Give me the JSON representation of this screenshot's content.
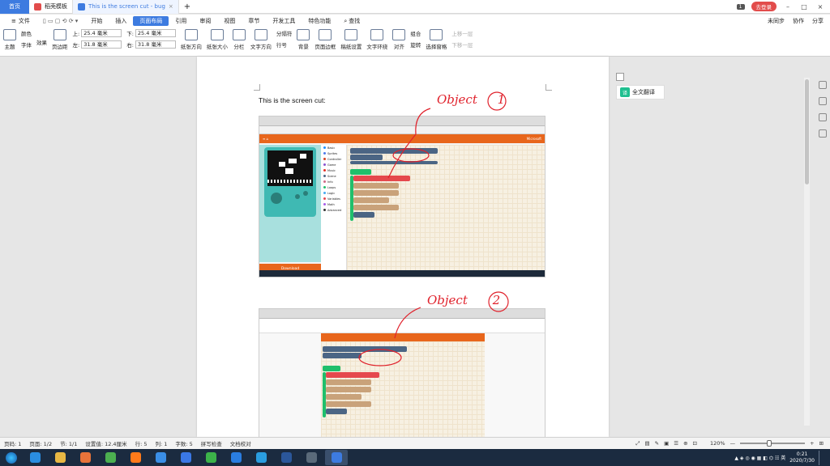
{
  "titlebar": {
    "home": "首页",
    "tabs": [
      {
        "label": "稻壳模板",
        "color": "#e24c4b",
        "active": false
      },
      {
        "label": "This is the screen cut - bug",
        "color": "#3d7be0",
        "active": true
      }
    ],
    "add_tab": "+",
    "badge": "1",
    "login": "去登录"
  },
  "menubar": {
    "file": "文件",
    "items": [
      "开始",
      "插入",
      "页面布局",
      "引用",
      "审阅",
      "视图",
      "章节",
      "开发工具",
      "特色功能"
    ],
    "active": "页面布局",
    "search": "查找",
    "right": [
      "未同步",
      "协作",
      "分享"
    ]
  },
  "ribbon": {
    "theme": "主题",
    "color": "颜色",
    "font": "字体",
    "effect": "效果",
    "margins": "页边距",
    "top_label": "上:",
    "top_value": "25.4 毫米",
    "bottom_label": "下:",
    "bottom_value": "25.4 毫米",
    "left_label": "左:",
    "left_value": "31.8 毫米",
    "right_label": "右:",
    "right_value": "31.8 毫米",
    "orientation": "纸张方向",
    "size": "纸张大小",
    "columns": "分栏",
    "text_direction": "文字方向",
    "breaks": "分隔符",
    "line_numbers": "行号",
    "background": "背景",
    "page_border": "页面边框",
    "manuscript": "稿纸设置",
    "wrap": "文字环绕",
    "align": "对齐",
    "group": "组合",
    "rotate": "旋转",
    "select_pane": "选择窗格",
    "bring_forward": "上移一层",
    "send_backward": "下移一层"
  },
  "document": {
    "text": "This is the screen cut:",
    "annotation1": "Object",
    "annotation1_num": "1",
    "annotation2": "Object",
    "annotation2_num": "2",
    "download": "Download",
    "microsoft": "Microsoft",
    "toolbox": [
      "Basic",
      "Sprites",
      "Controller",
      "Game",
      "Music",
      "Scene",
      "Info",
      "Loops",
      "Logic",
      "Variables",
      "Math",
      "Advanced"
    ]
  },
  "sidepanel": {
    "translate": "全文翻译"
  },
  "statusbar": {
    "page_num": "页码: 1",
    "pages": "页面: 1/2",
    "section": "节: 1/1",
    "setting": "设置值: 12.4厘米",
    "row": "行: 5",
    "col": "列: 1",
    "words": "字数: 5",
    "spell": "拼写检查",
    "proof": "文档校对",
    "zoom": "120%",
    "zoom_fraction": 0.45
  },
  "taskbar": {
    "apps": [
      {
        "icon": "ie-icon",
        "color": "#2a8de0"
      },
      {
        "icon": "folder-icon",
        "color": "#e8b844"
      },
      {
        "icon": "store-icon",
        "color": "#e8733a"
      },
      {
        "icon": "chrome-icon",
        "color": "#4caf50"
      },
      {
        "icon": "firefox-icon",
        "color": "#ff7a1a"
      },
      {
        "icon": "calculator-icon",
        "color": "#3a8ee6"
      },
      {
        "icon": "feishu-icon",
        "color": "#3a78e6"
      },
      {
        "icon": "wechat-icon",
        "color": "#3cb34a"
      },
      {
        "icon": "vpn-icon",
        "color": "#2a7de0"
      },
      {
        "icon": "cloud-icon",
        "color": "#2a9de0"
      },
      {
        "icon": "word-icon",
        "color": "#2b579a"
      },
      {
        "icon": "media-icon",
        "color": "#5a6a7a"
      },
      {
        "icon": "wps-icon",
        "color": "#3d7be0"
      }
    ],
    "time": "0:21",
    "date": "2020/7/30"
  }
}
